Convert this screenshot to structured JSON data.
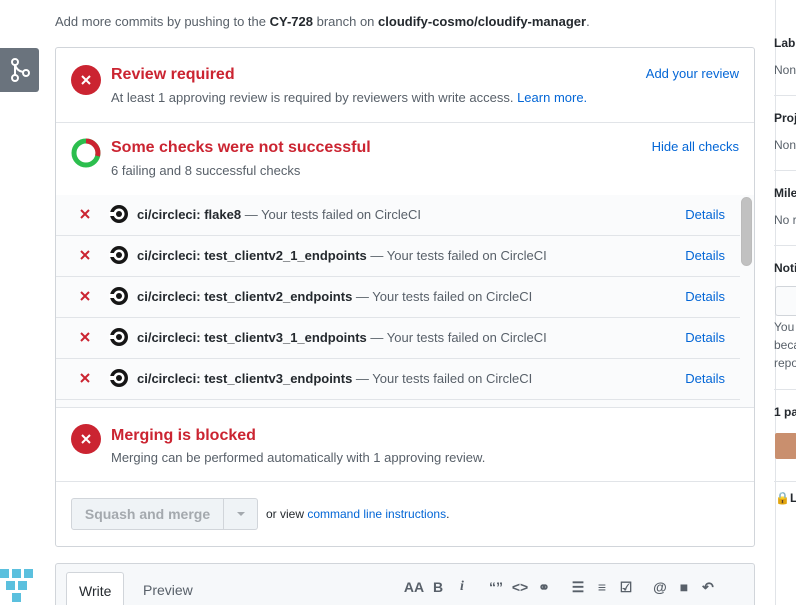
{
  "intro": {
    "prefix": "Add more commits by pushing to the ",
    "branch": "CY-728",
    "middle": " branch on ",
    "repo": "cloudify-cosmo/cloudify-manager",
    "suffix": "."
  },
  "review": {
    "title": "Review required",
    "subtitle": "At least 1 approving review is required by reviewers with write access.",
    "learn_more": "Learn more.",
    "action": "Add your review"
  },
  "checks": {
    "title": "Some checks were not successful",
    "subtitle": "6 failing and 8 successful checks",
    "action": "Hide all checks",
    "items": [
      {
        "name": "ci/circleci: flake8",
        "desc": " — Your tests failed on CircleCI",
        "details": "Details"
      },
      {
        "name": "ci/circleci: test_clientv2_1_endpoints",
        "desc": " — Your tests failed on CircleCI",
        "details": "Details"
      },
      {
        "name": "ci/circleci: test_clientv2_endpoints",
        "desc": " — Your tests failed on CircleCI",
        "details": "Details"
      },
      {
        "name": "ci/circleci: test_clientv3_1_endpoints",
        "desc": " — Your tests failed on CircleCI",
        "details": "Details"
      },
      {
        "name": "ci/circleci: test_clientv3_endpoints",
        "desc": " — Your tests failed on CircleCI",
        "details": "Details"
      }
    ]
  },
  "merging": {
    "title": "Merging is blocked",
    "subtitle": "Merging can be performed automatically with 1 approving review.",
    "button": "Squash and merge",
    "or_view": "or view ",
    "cli_link": "command line instructions",
    "period": "."
  },
  "editor": {
    "tab_write": "Write",
    "tab_preview": "Preview",
    "toolbar": [
      "AA",
      "B",
      "i",
      "“”",
      "<>",
      "⚭",
      "☰",
      "≡",
      "☑",
      "@",
      "■",
      "↶"
    ]
  },
  "sidebar": {
    "labels": "Lab",
    "labels_value": "Non",
    "projects": "Proj",
    "projects_value": "Non",
    "milestone": "Mile",
    "milestone_value": "No r",
    "notifications": "Noti",
    "notif_text": [
      "You",
      "beca",
      "repo"
    ],
    "participants": "1 pa",
    "lock": "L"
  },
  "colors": {
    "error": "#cb2431",
    "success": "#2cbe4e",
    "link": "#0366d6"
  }
}
